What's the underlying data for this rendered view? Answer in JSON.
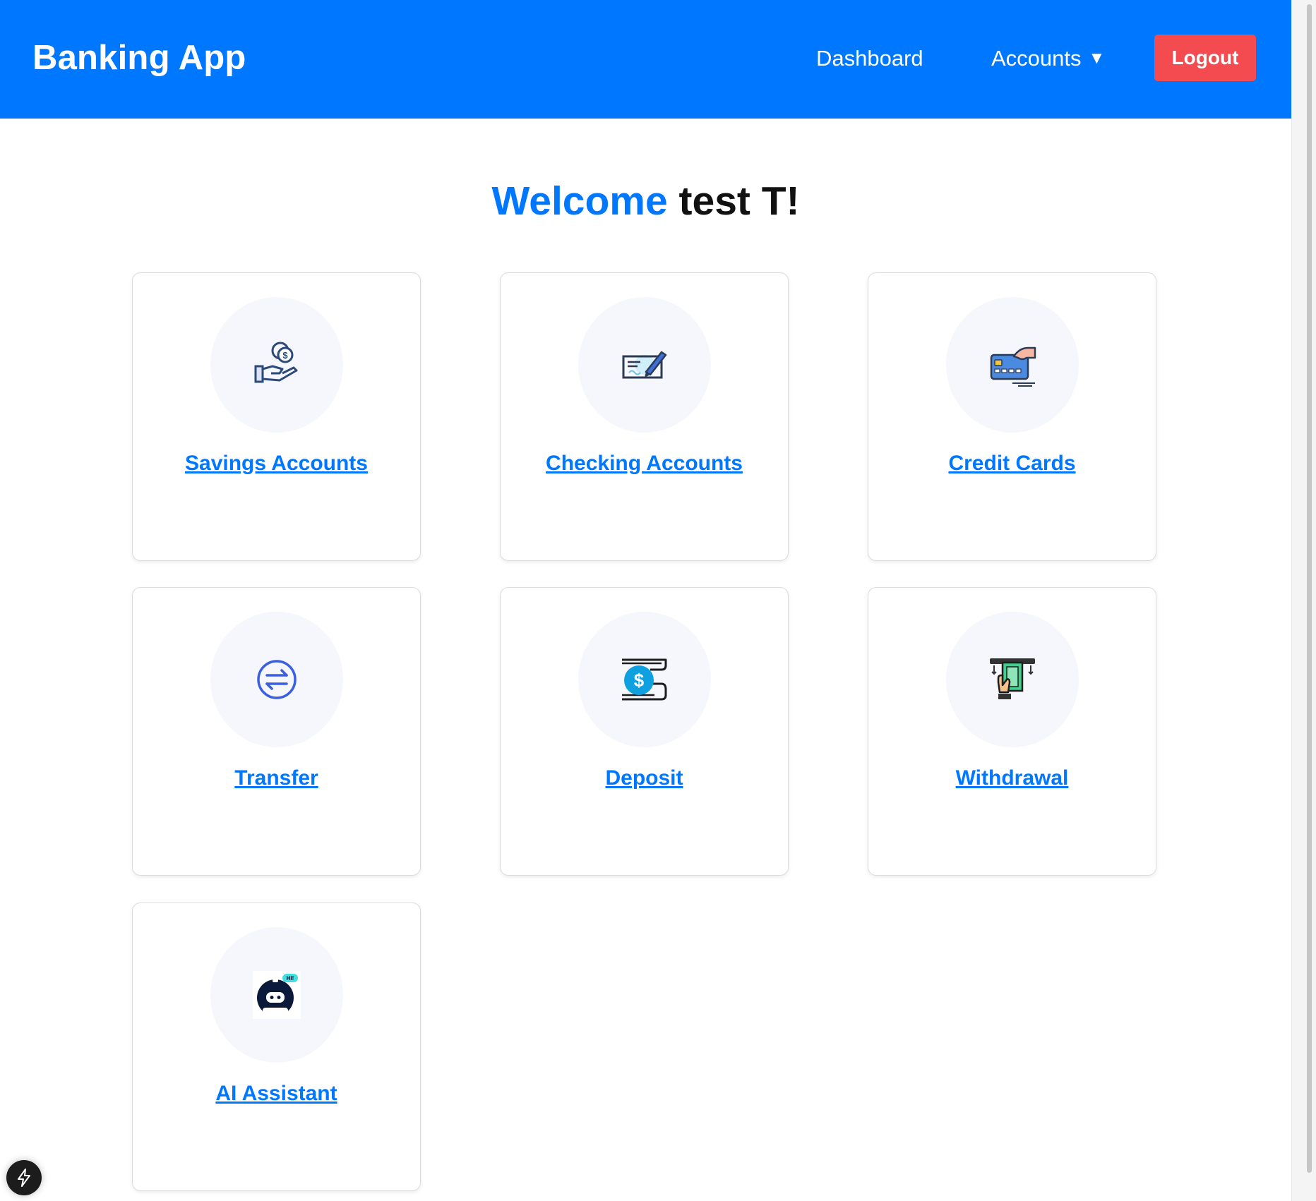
{
  "header": {
    "brand": "Banking App",
    "nav": {
      "dashboard": "Dashboard",
      "accounts": "Accounts"
    },
    "logout_label": "Logout"
  },
  "welcome": {
    "greeting": "Welcome",
    "name": "test T!"
  },
  "cards": [
    {
      "label": "Savings Accounts",
      "icon": "hand-coin-icon"
    },
    {
      "label": "Checking Accounts",
      "icon": "check-pen-icon"
    },
    {
      "label": "Credit Cards",
      "icon": "credit-card-hand-icon"
    },
    {
      "label": "Transfer",
      "icon": "transfer-arrows-icon"
    },
    {
      "label": "Deposit",
      "icon": "deposit-dollar-icon"
    },
    {
      "label": "Withdrawal",
      "icon": "atm-withdrawal-icon"
    },
    {
      "label": "AI Assistant",
      "icon": "robot-assistant-icon"
    }
  ],
  "colors": {
    "primary": "#0077ff",
    "logout": "#f44b50",
    "icon_circle_bg": "#f6f7fd"
  }
}
